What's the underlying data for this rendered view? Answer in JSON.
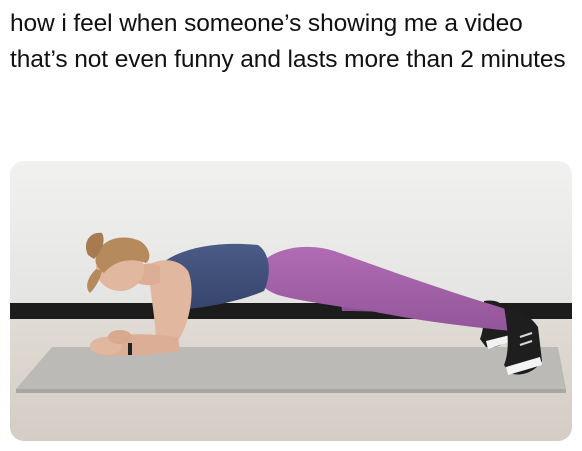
{
  "post": {
    "caption": "how i feel when someone’s showing me a video that’s not even funny and lasts more than 2 minutes"
  },
  "image": {
    "subject-icon": "person-plank-photo",
    "colors": {
      "wall": "#ececea",
      "floor": "#d8d2ca",
      "baseboard": "#1c1c1c",
      "mat": "#b9b7b4",
      "top": "#3f4f78",
      "leggings": "#a564a8",
      "skin": "#e2b7a0",
      "hair": "#b58a5c",
      "shoes": "#1e1e1e"
    }
  }
}
